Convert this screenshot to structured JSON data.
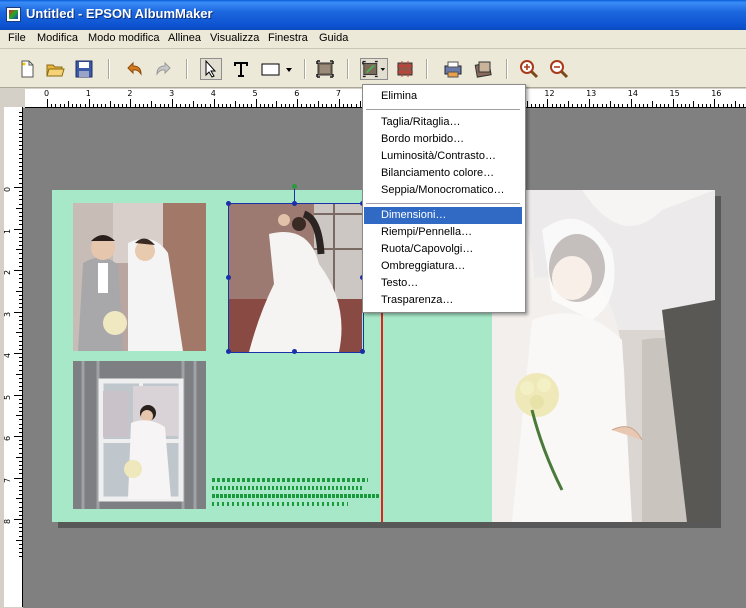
{
  "window": {
    "title": "Untitled - EPSON AlbumMaker"
  },
  "menubar": [
    "File",
    "Modifica",
    "Modo modifica",
    "Allinea",
    "Visualizza",
    "Finestra",
    "Guida"
  ],
  "ruler": {
    "horizontal_labels": [
      "0",
      "1",
      "2",
      "3",
      "4",
      "5",
      "6",
      "7",
      "8",
      "9",
      "10",
      "11",
      "12",
      "13",
      "14",
      "15",
      "16"
    ],
    "vertical_labels": [
      "0",
      "1",
      "2",
      "3",
      "4",
      "5",
      "6",
      "7",
      "8"
    ]
  },
  "dropdown": {
    "items": [
      "Elimina",
      "Taglia/Ritaglia…",
      "Bordo morbido…",
      "Luminosità/Contrasto…",
      "Bilanciamento colore…",
      "Seppia/Monocromatico…",
      "Dimensioni…",
      "Riempi/Pennella…",
      "Ruota/Capovolgi…",
      "Ombreggiatura…",
      "Testo…",
      "Trasparenza…"
    ],
    "active_index": 6
  },
  "colors": {
    "page_left": "#a7e8c8",
    "fold_line": "#e2231a",
    "menu_highlight": "#316ac5",
    "selection": "#1a2fa8",
    "caption_text": "#1a9a3a"
  }
}
